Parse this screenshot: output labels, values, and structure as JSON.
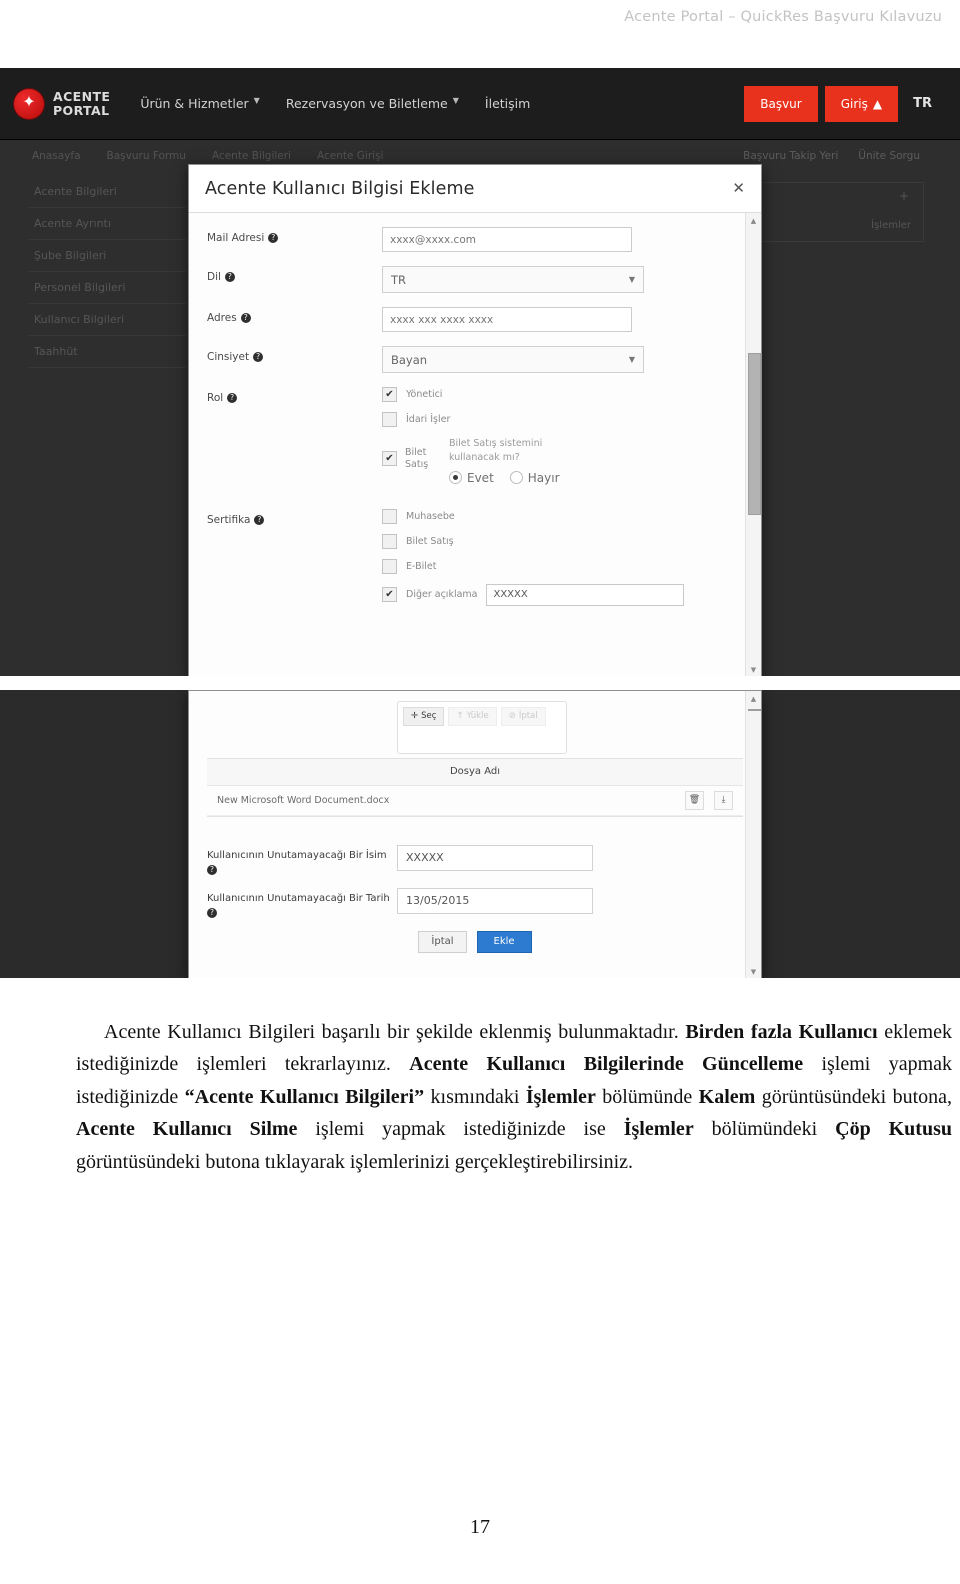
{
  "document": {
    "running_header": "Acente Portal – QuickRes Başvuru Kılavuzu",
    "page_number": "17",
    "paragraph": {
      "p1_a": "Acente Kullanıcı Bilgileri başarılı bir şekilde eklenmiş bulunmaktadır. ",
      "p1_b": "Birden fazla Kullanıcı",
      "p1_c": " eklemek istediğinizde işlemleri tekrarlayınız. ",
      "p1_d": "Acente Kullanıcı Bilgilerinde Güncelleme",
      "p1_e": " işlemi yapmak istediğinizde ",
      "p1_f": "“Acente Kullanıcı Bilgileri”",
      "p1_g": " kısmındaki ",
      "p1_h": "İşlemler",
      "p1_i": " bölümünde ",
      "p1_j": "Kalem",
      "p1_k": " görüntüsündeki butona, ",
      "p1_l": "Acente Kullanıcı Silme",
      "p1_m": " işlemi yapmak istediğinizde ise ",
      "p1_n": "İşlemler",
      "p1_o": " bölümündeki ",
      "p1_p": "Çöp Kutusu",
      "p1_q": " görüntüsündeki butona tıklayarak işlemlerinizi gerçekleştirebilirsiniz."
    }
  },
  "navbar": {
    "brand_line1": "ACENTE",
    "brand_line2": "PORTAL",
    "logo_glyph": "✦",
    "links": [
      {
        "label": "Ürün & Hizmetler",
        "caret": "▼"
      },
      {
        "label": "Rezervasyon ve Biletleme",
        "caret": "▼"
      },
      {
        "label": "İletişim",
        "caret": ""
      }
    ],
    "apply_button": "Başvur",
    "login_button": "Giriş",
    "login_icon": "▲",
    "language": "TR",
    "accent_color": "#e8321e"
  },
  "background_page": {
    "breadcrumbs": [
      "Anasayfa",
      "Başvuru Formu",
      "Acente Bilgileri",
      "Acente Girişi"
    ],
    "right_links": [
      "Başvuru Takip Yeri",
      "Ünite Sorgu"
    ],
    "sidebar": [
      "Acente Bilgileri",
      "Acente Ayrıntı",
      "Şube Bilgileri",
      "Personel Bilgileri",
      "Kullanıcı Bilgileri",
      "Taahhüt"
    ],
    "panel_label": "İşlemler",
    "panel_plus": "+"
  },
  "modal": {
    "title": "Acente Kullanıcı Bilgisi Ekleme",
    "close_icon": "✕",
    "help_icon": "?",
    "scroll_up": "▲",
    "scroll_down": "▼",
    "fields": {
      "mail_label": "Mail Adresi",
      "mail_value": "xxxx@xxxx.com",
      "lang_label": "Dil",
      "lang_value": "TR",
      "address_label": "Adres",
      "address_value": "xxxx xxx  xxxx xxxx",
      "gender_label": "Cinsiyet",
      "gender_value": "Bayan",
      "role_label": "Rol",
      "certificate_label": "Sertifika",
      "select_caret": "▼"
    },
    "roles": [
      {
        "label": "Yönetici",
        "checked": true
      },
      {
        "label": "İdari İşler",
        "checked": false
      }
    ],
    "ticket_role": {
      "label_line1": "Bilet",
      "label_line2": "Satış",
      "checked": true,
      "question_line1": "Bilet Satış sistemini",
      "question_line2": "kullanacak mı?",
      "option_yes": "Evet",
      "option_no": "Hayır",
      "selected": "Evet"
    },
    "certificates": [
      {
        "label": "Muhasebe",
        "checked": false
      },
      {
        "label": "Bilet Satış",
        "checked": false
      },
      {
        "label": "E-Bilet",
        "checked": false
      }
    ],
    "other_certificate": {
      "label": "Diğer açıklama",
      "checked": true,
      "value": "XXXXX"
    },
    "check_glyph": "✔",
    "file_picker": {
      "select_button": "Seç",
      "plus_icon": "✛",
      "upload_button": "Yükle",
      "clear_button": "İptal",
      "upload_icon": "↑",
      "clear_icon": "⊘"
    },
    "file_table": {
      "column_header": "Dosya Adı",
      "rows": [
        {
          "name": "New Microsoft Word Document.docx",
          "delete_icon": "🗑",
          "download_icon": "⤓"
        }
      ]
    },
    "memorable": {
      "name_label": "Kullanıcının Unutamayacağı Bir İsim",
      "name_value": "XXXXX",
      "date_label": "Kullanıcının Unutamayacağı Bir Tarih",
      "date_value": "13/05/2015"
    },
    "actions": {
      "cancel": "İptal",
      "submit": "Ekle",
      "submit_color": "#2d7bd0"
    }
  }
}
